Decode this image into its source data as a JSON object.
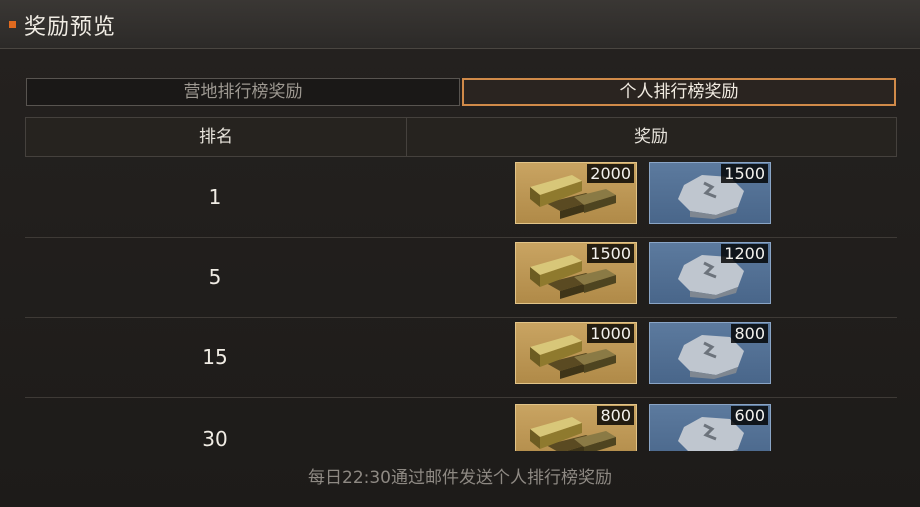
{
  "header": {
    "title": "奖励预览"
  },
  "tabs": [
    {
      "label": "营地排行榜奖励",
      "active": false
    },
    {
      "label": "个人排行榜奖励",
      "active": true
    }
  ],
  "table": {
    "headers": {
      "rank": "排名",
      "reward": "奖励"
    },
    "rows": [
      {
        "rank": "1",
        "rewards": [
          {
            "icon": "gold-bars-icon",
            "count": "2000"
          },
          {
            "icon": "silver-ore-icon",
            "count": "1500"
          }
        ]
      },
      {
        "rank": "5",
        "rewards": [
          {
            "icon": "gold-bars-icon",
            "count": "1500"
          },
          {
            "icon": "silver-ore-icon",
            "count": "1200"
          }
        ]
      },
      {
        "rank": "15",
        "rewards": [
          {
            "icon": "gold-bars-icon",
            "count": "1000"
          },
          {
            "icon": "silver-ore-icon",
            "count": "800"
          }
        ]
      },
      {
        "rank": "30",
        "rewards": [
          {
            "icon": "gold-bars-icon",
            "count": "800"
          },
          {
            "icon": "silver-ore-icon",
            "count": "600"
          }
        ]
      }
    ]
  },
  "footer": {
    "note": "每日22:30通过邮件发送个人排行榜奖励"
  },
  "colors": {
    "accent": "#d08a49",
    "marker": "#e06a1f",
    "gold_tile": "#c9a462",
    "silver_tile": "#5c7a9e"
  }
}
